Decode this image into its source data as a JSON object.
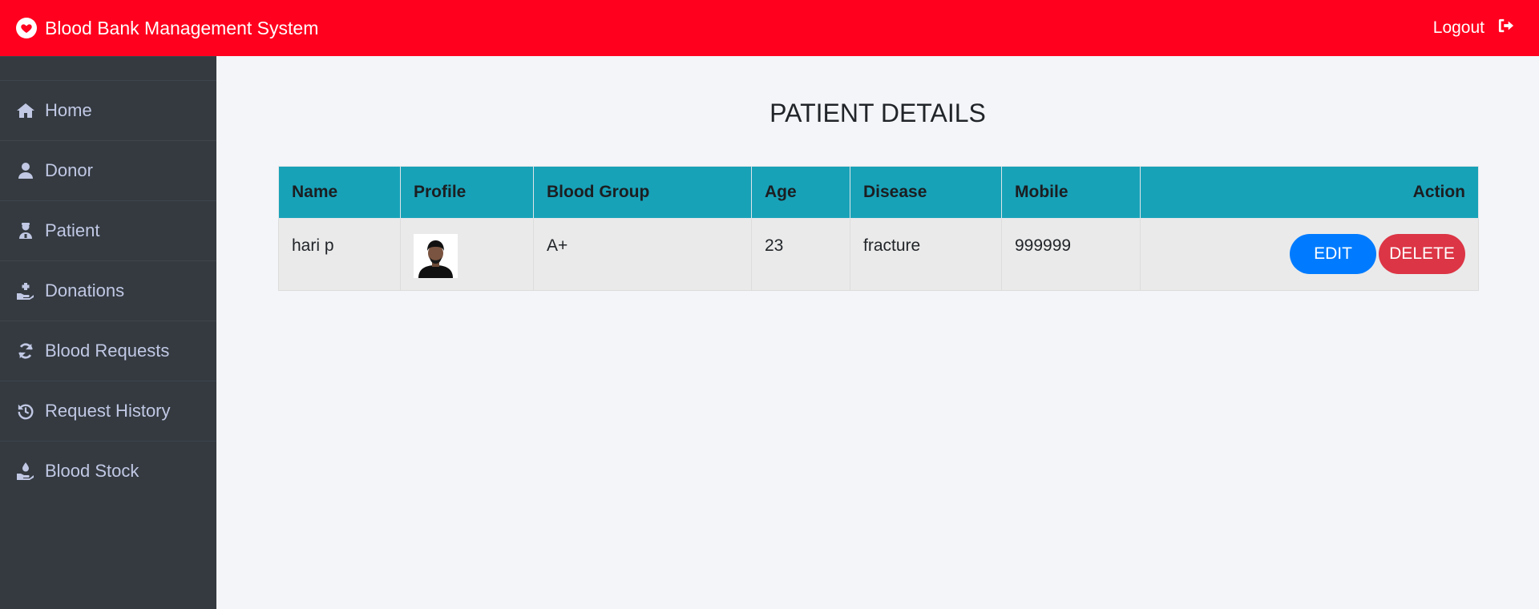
{
  "header": {
    "title": "Blood Bank Management System",
    "logout_label": "Logout",
    "bg_color": "#ff001e"
  },
  "sidebar": {
    "items": [
      {
        "label": "Home",
        "icon": "home-icon"
      },
      {
        "label": "Donor",
        "icon": "user-icon"
      },
      {
        "label": "Patient",
        "icon": "patient-icon"
      },
      {
        "label": "Donations",
        "icon": "hand-donate-icon"
      },
      {
        "label": "Blood Requests",
        "icon": "refresh-icon"
      },
      {
        "label": "Request History",
        "icon": "history-icon"
      },
      {
        "label": "Blood Stock",
        "icon": "hand-drop-icon"
      }
    ]
  },
  "main": {
    "title": "PATIENT DETAILS",
    "table": {
      "headers": [
        "Name",
        "Profile",
        "Blood Group",
        "Age",
        "Disease",
        "Mobile",
        "Action"
      ],
      "rows": [
        {
          "name": "hari p",
          "blood_group": "A+",
          "age": "23",
          "disease": "fracture",
          "mobile": "999999",
          "edit_label": "EDIT",
          "delete_label": "DELETE"
        }
      ]
    }
  }
}
